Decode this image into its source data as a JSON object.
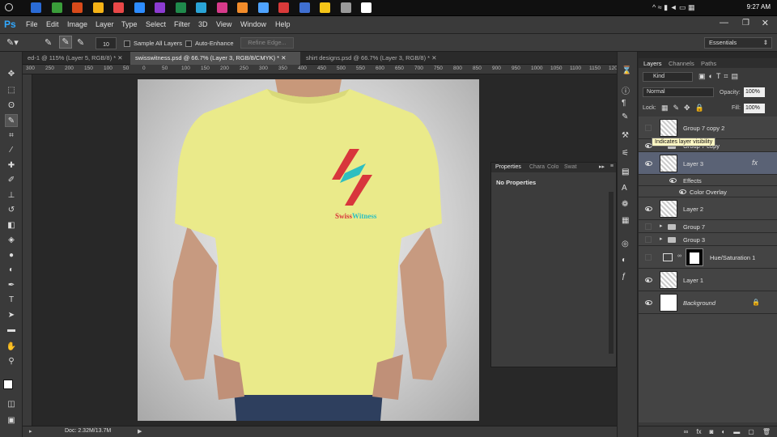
{
  "taskbar": {
    "clock": "9:27 AM",
    "icon_colors": [
      "#2a6bd6",
      "#3a9d3a",
      "#d84a1a",
      "#f5b316",
      "#e94848",
      "#2d8cff",
      "#8c3bd1",
      "#1f8a4c",
      "#2aa4d6",
      "#d63a8a",
      "#f28c2a",
      "#4fa3ff",
      "#d93a3a",
      "#3f6fd1",
      "#f5c518",
      "#999999",
      "#ffffff"
    ]
  },
  "menubar": {
    "app_logo": "Ps",
    "items": [
      "File",
      "Edit",
      "Image",
      "Layer",
      "Type",
      "Select",
      "Filter",
      "3D",
      "View",
      "Window",
      "Help"
    ]
  },
  "options": {
    "brush_size": "10",
    "sample_all_layers": "Sample All Layers",
    "auto_enhance": "Auto-Enhance",
    "refine_edge": "Refine Edge...",
    "workspace": "Essentials"
  },
  "tabs": [
    {
      "label": "ed-1 @ 115% (Layer 5, RGB/8) *"
    },
    {
      "label": "swisswitness.psd @ 66.7% (Layer 3, RGB/8/CMYK) *"
    },
    {
      "label": "shirt designs.psd @ 66.7% (Layer 3, RGB/8) *"
    }
  ],
  "ruler": [
    "300",
    "250",
    "200",
    "150",
    "100",
    "50",
    "0",
    "50",
    "100",
    "150",
    "200",
    "250",
    "300",
    "350",
    "400",
    "450",
    "500",
    "550",
    "600",
    "650",
    "700",
    "750",
    "800",
    "850",
    "900",
    "950",
    "1000",
    "1050",
    "1100",
    "1150",
    "1200"
  ],
  "status": {
    "doc": "Doc: 2.32M/13.7M"
  },
  "logo": {
    "text": "SwissWitness",
    "part1": "Swiss",
    "part2": "Witness"
  },
  "properties": {
    "tabs": [
      "Properties",
      "Chara",
      "Colo",
      "Swat"
    ],
    "content": "No Properties"
  },
  "layers_panel": {
    "tabs": [
      "Layers",
      "Channels",
      "Paths"
    ],
    "filter": "Kind",
    "blend_mode": "Normal",
    "opacity_label": "Opacity:",
    "opacity": "100%",
    "lock_label": "Lock:",
    "fill_label": "Fill:",
    "fill": "100%",
    "tooltip": "Indicates layer visibility",
    "layers": [
      {
        "name": "Group 7 copy 2"
      },
      {
        "name": "Group 7 copy"
      },
      {
        "name": "Layer 3"
      },
      {
        "name": "Effects"
      },
      {
        "name": "Color Overlay"
      },
      {
        "name": "Layer 2"
      },
      {
        "name": "Group 7"
      },
      {
        "name": "Group 3"
      },
      {
        "name": "Hue/Saturation 1"
      },
      {
        "name": "Layer 1"
      },
      {
        "name": "Background"
      }
    ]
  },
  "colors": {
    "accent": "#31a8ff",
    "shirt": "#eaea8a",
    "logo_red": "#d8363c",
    "logo_teal": "#2fbfc0"
  }
}
